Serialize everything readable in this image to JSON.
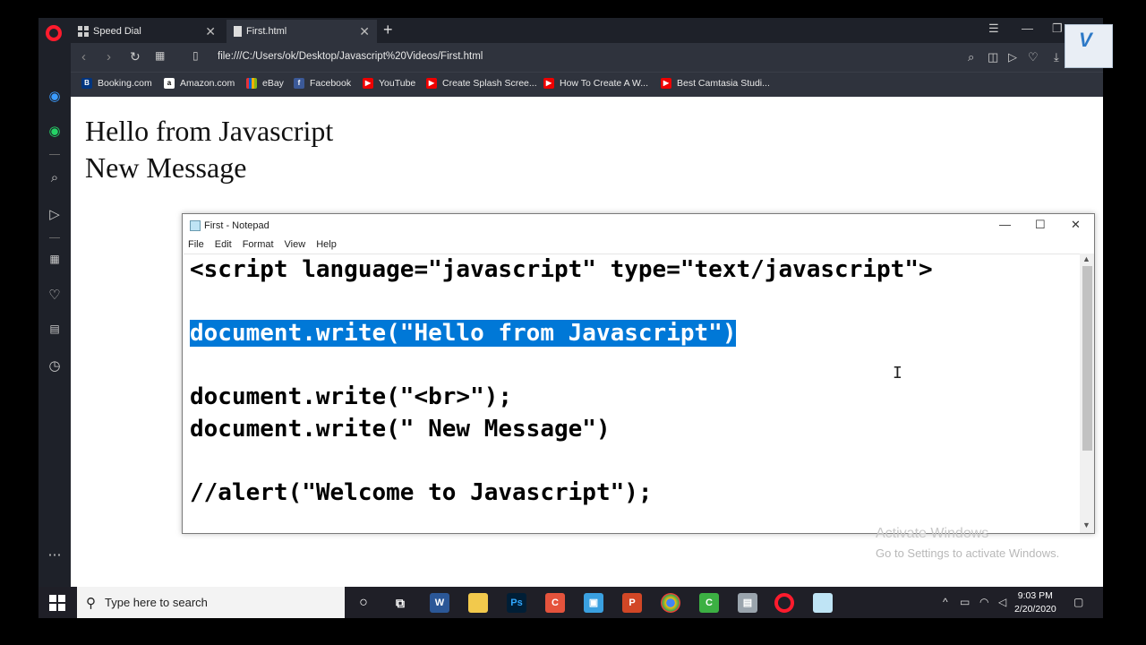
{
  "browser": {
    "tabs": [
      {
        "label": "Speed Dial",
        "active": false
      },
      {
        "label": "First.html",
        "active": true
      }
    ],
    "url": "file:///C:/Users/ok/Desktop/Javascript%20Videos/First.html",
    "bookmarks": [
      "Booking.com",
      "Amazon.com",
      "eBay",
      "Facebook",
      "YouTube",
      "Create Splash Scree...",
      "How To Create A W...",
      "Best Camtasia Studi..."
    ]
  },
  "page": {
    "line1": "Hello from Javascript",
    "line2": "New Message"
  },
  "notepad": {
    "title": "First - Notepad",
    "menu": [
      "File",
      "Edit",
      "Format",
      "View",
      "Help"
    ],
    "lines": [
      "<script language=\"javascript\" type=\"text/javascript\">",
      "",
      "document.write(\"Hello from Javascript\")",
      "",
      "document.write(\"<br>\");",
      "document.write(\" New Message\")",
      "",
      "//alert(\"Welcome to Javascript\");"
    ],
    "selected_line_index": 2
  },
  "watermark": {
    "title": "Activate Windows",
    "subtitle": "Go to Settings to activate Windows."
  },
  "taskbar": {
    "search_placeholder": "Type here to search",
    "time": "9:03 PM",
    "date": "2/20/2020"
  },
  "colors": {
    "selection": "#0078d7",
    "opera_red": "#ff1b2d",
    "chrome_dark": "#1e2129"
  }
}
